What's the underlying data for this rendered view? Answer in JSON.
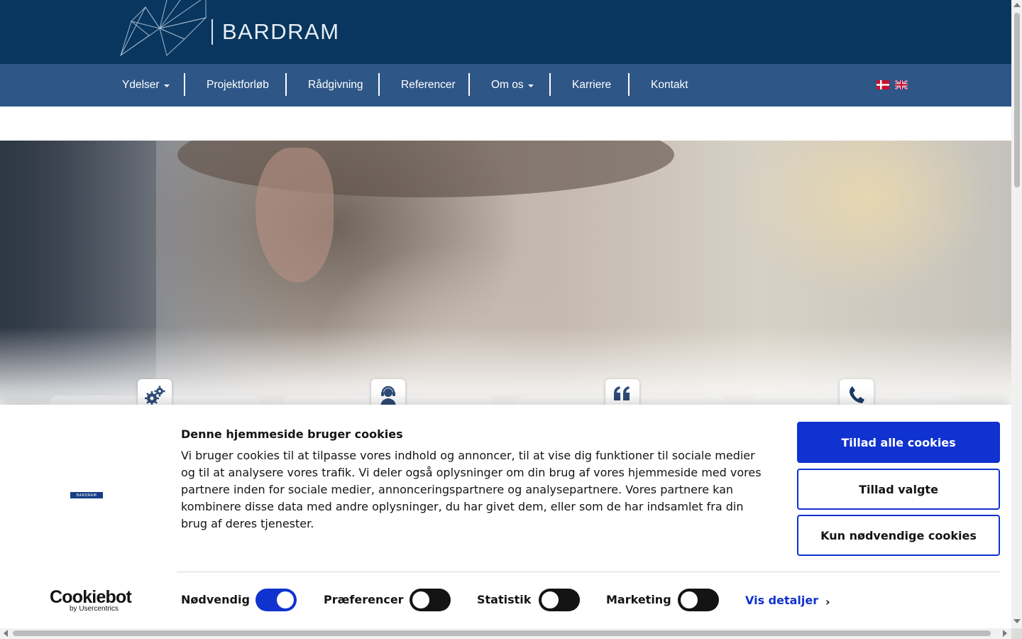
{
  "header": {
    "brand": "BARDRAM"
  },
  "nav": {
    "items": [
      {
        "label": "Ydelser",
        "dropdown": true
      },
      {
        "label": "Projektforløb",
        "dropdown": false
      },
      {
        "label": "Rådgivning",
        "dropdown": false
      },
      {
        "label": "Referencer",
        "dropdown": false
      },
      {
        "label": "Om os",
        "dropdown": true
      },
      {
        "label": "Karriere",
        "dropdown": false
      },
      {
        "label": "Kontakt",
        "dropdown": false
      }
    ],
    "languages": [
      "da-flag-icon",
      "en-flag-icon"
    ]
  },
  "features": {
    "icons": [
      "gears-icon",
      "support-agent-icon",
      "quote-icon",
      "phone-icon"
    ]
  },
  "cookie": {
    "logo_text": "BARDRAM",
    "title": "Denne hjemmeside bruger cookies",
    "body": "Vi bruger cookies til at tilpasse vores indhold og annoncer, til at vise dig funktioner til sociale medier og til at analysere vores trafik. Vi deler også oplysninger om din brug af vores hjemmeside med vores partnere inden for sociale medier, annonceringspartnere og analysepartnere. Vores partnere kan kombinere disse data med andre oplysninger, du har givet dem, eller som de har indsamlet fra din brug af deres tjenester.",
    "buttons": {
      "allow_all": "Tillad alle cookies",
      "allow_selected": "Tillad valgte",
      "necessary_only": "Kun nødvendige cookies"
    },
    "brand_main": "Cookiebot",
    "brand_sub": "by Usercentrics",
    "toggles": [
      {
        "label": "Nødvendig",
        "on": true
      },
      {
        "label": "Præferencer",
        "on": false
      },
      {
        "label": "Statistik",
        "on": false
      },
      {
        "label": "Marketing",
        "on": false
      }
    ],
    "details_link": "Vis detaljer"
  },
  "colors": {
    "header_bg": "#08365f",
    "nav_bg": "#2e5687",
    "cookie_accent": "#1032cf"
  }
}
